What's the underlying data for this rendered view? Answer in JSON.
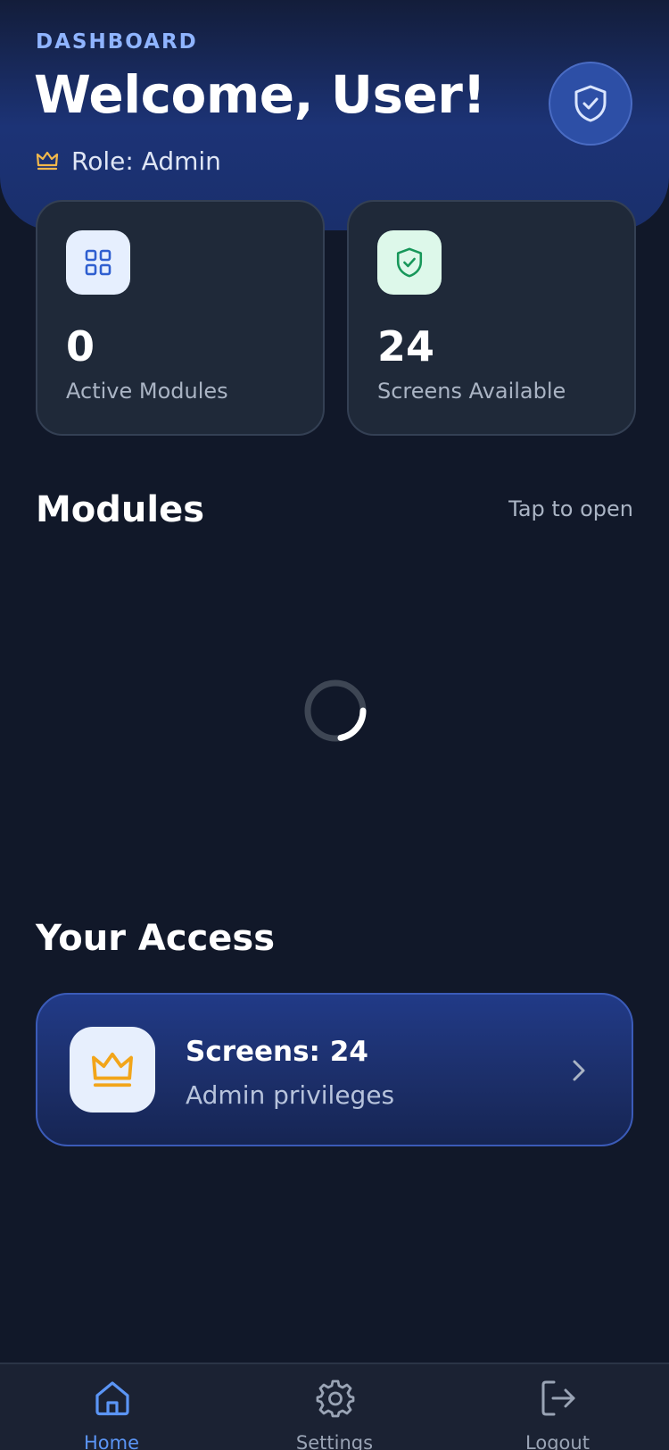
{
  "header": {
    "eyebrow": "DASHBOARD",
    "title": "Welcome, User!",
    "role_text": "Role: Admin"
  },
  "stats": [
    {
      "value": "0",
      "label": "Active Modules",
      "icon": "grid-icon",
      "icon_bg": "#e6effe",
      "icon_color": "#2f5fd0"
    },
    {
      "value": "24",
      "label": "Screens Available",
      "icon": "shield-check-icon",
      "icon_bg": "#ddf8ea",
      "icon_color": "#17975a"
    }
  ],
  "modules": {
    "title": "Modules",
    "hint": "Tap to open",
    "loading": true
  },
  "access": {
    "title": "Your Access",
    "card_title": "Screens: 24",
    "card_subtitle": "Admin privileges",
    "icon": "crown-icon"
  },
  "nav": {
    "items": [
      {
        "label": "Home",
        "icon": "home-icon",
        "active": true
      },
      {
        "label": "Settings",
        "icon": "gear-icon",
        "active": false
      },
      {
        "label": "Logout",
        "icon": "logout-icon",
        "active": false
      }
    ]
  },
  "colors": {
    "background": "#111829",
    "accent": "#5b95f5",
    "crown": "#f2a51a",
    "muted": "#aab4c4"
  }
}
